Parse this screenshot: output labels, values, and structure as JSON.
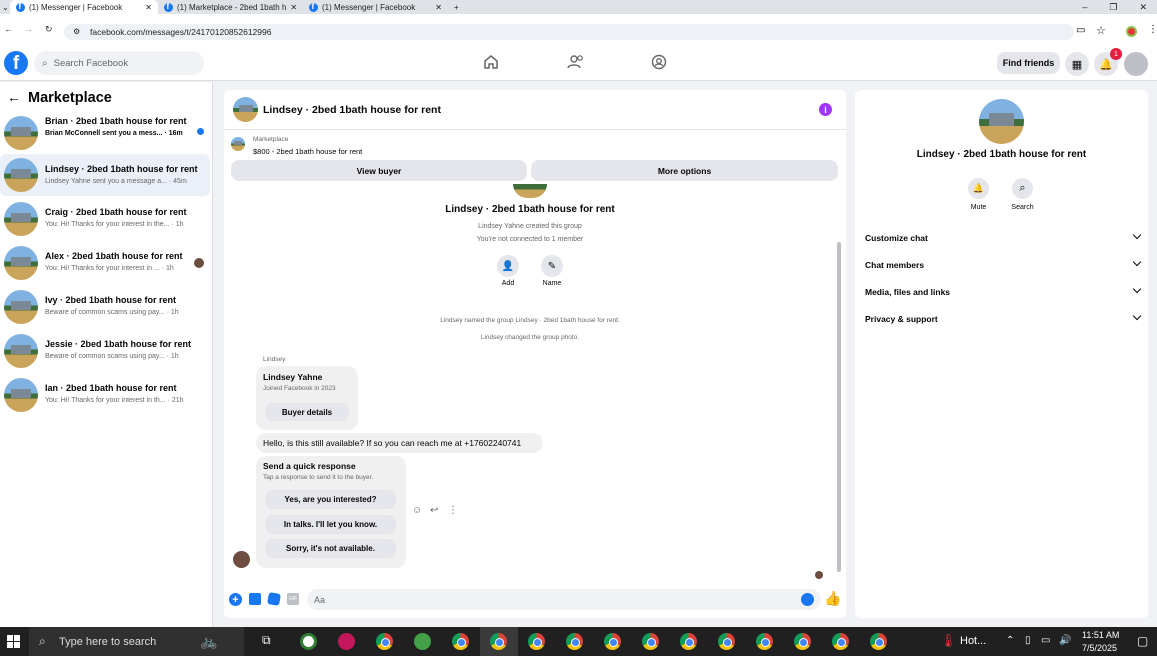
{
  "browser": {
    "tabs": [
      {
        "title": "(1) Messenger | Facebook",
        "active": true
      },
      {
        "title": "(1) Marketplace - 2bed 1bath h",
        "active": false
      },
      {
        "title": "(1) Messenger | Facebook",
        "active": false
      }
    ],
    "url": "facebook.com/messages/t/24170120852612996"
  },
  "header": {
    "search_placeholder": "Search Facebook",
    "find_friends": "Find friends",
    "notif_count": "1"
  },
  "sidebar": {
    "title": "Marketplace",
    "conversations": [
      {
        "name": "Brian · 2bed 1bath house for rent",
        "snippet": "Brian McConnell sent you a mess... · 16m",
        "unread": true
      },
      {
        "name": "Lindsey · 2bed 1bath house for rent",
        "snippet": "Lindsey Yahne sent you a message a... · 45m",
        "selected": true
      },
      {
        "name": "Craig · 2bed 1bath house for rent",
        "snippet": "You: Hi! Thanks for your interest in the... · 1h"
      },
      {
        "name": "Alex · 2bed 1bath house for rent",
        "snippet": "You: Hi! Thanks for your interest in ... · 1h"
      },
      {
        "name": "Ivy · 2bed 1bath house for rent",
        "snippet": "Beware of common scams using pay... · 1h"
      },
      {
        "name": "Jessie · 2bed 1bath house for rent",
        "snippet": "Beware of common scams using pay... · 1h"
      },
      {
        "name": "Ian · 2bed 1bath house for rent",
        "snippet": "You: Hi! Thanks for your interest in th... · 21h"
      }
    ]
  },
  "chat": {
    "title": "Lindsey · 2bed 1bath house for rent",
    "listing_label": "Marketplace",
    "listing_detail": "$800 - 2bed 1bath house for rent",
    "view_buyer": "View buyer",
    "more_options": "More options",
    "group_name": "Lindsey · 2bed 1bath house for rent",
    "created_by": "Lindsey Yahne created this group",
    "not_connected": "You're not connected to 1 member",
    "add_label": "Add",
    "name_label": "Name",
    "event1": "Lindsey named the group Lindsey · 2bed 1bath house for rent.",
    "event2": "Lindsey changed the group photo.",
    "sender_label": "Lindsey",
    "card_name": "Lindsey Yahne",
    "card_joined": "Joined Facebook in 2023",
    "buyer_details": "Buyer details",
    "message": "Hello, is this still available? If so you can reach me at +17602240741",
    "quick_title": "Send a quick response",
    "quick_sub": "Tap a response to send it to the buyer.",
    "quick_replies": [
      "Yes, are you interested?",
      "In talks. I'll let you know.",
      "Sorry, it's not available."
    ],
    "composer_placeholder": "Aa"
  },
  "info": {
    "title": "Lindsey · 2bed 1bath house for rent",
    "mute": "Mute",
    "search": "Search",
    "sections": [
      "Customize chat",
      "Chat members",
      "Media, files and links",
      "Privacy & support"
    ]
  },
  "taskbar": {
    "search_placeholder": "Type here to search",
    "weather": "Hot...",
    "time": "11:51 AM",
    "date": "7/5/2025"
  },
  "colors": {
    "fb_blue": "#1877f2",
    "accent_purple": "#a033ff",
    "taskbar": "#202020"
  }
}
